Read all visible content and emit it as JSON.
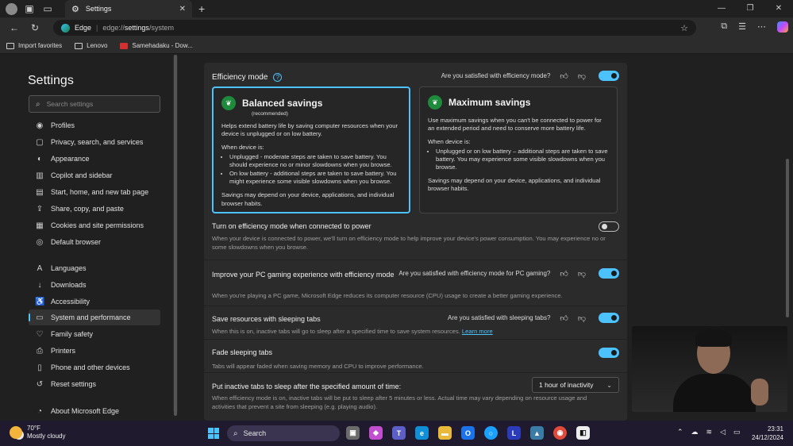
{
  "browser": {
    "tab_title": "Settings",
    "address_site": "Edge",
    "address_url_prefix": "edge://",
    "address_url_bold": "settings",
    "address_url_suffix": "/system",
    "favorites": [
      {
        "label": "Import favorites"
      },
      {
        "label": "Lenovo"
      },
      {
        "label": "Samehadaku - Dow..."
      }
    ]
  },
  "sidebar": {
    "title": "Settings",
    "search_placeholder": "Search settings",
    "items": [
      {
        "label": "Profiles",
        "icon": "profile-icon"
      },
      {
        "label": "Privacy, search, and services",
        "icon": "lock-icon"
      },
      {
        "label": "Appearance",
        "icon": "palette-icon"
      },
      {
        "label": "Copilot and sidebar",
        "icon": "sidebar-icon"
      },
      {
        "label": "Start, home, and new tab page",
        "icon": "home-icon"
      },
      {
        "label": "Share, copy, and paste",
        "icon": "share-icon"
      },
      {
        "label": "Cookies and site permissions",
        "icon": "cookie-icon"
      },
      {
        "label": "Default browser",
        "icon": "browser-icon"
      },
      {
        "label": "Languages",
        "icon": "language-icon"
      },
      {
        "label": "Downloads",
        "icon": "download-icon"
      },
      {
        "label": "Accessibility",
        "icon": "accessibility-icon"
      },
      {
        "label": "System and performance",
        "icon": "laptop-icon"
      },
      {
        "label": "Family safety",
        "icon": "family-icon"
      },
      {
        "label": "Printers",
        "icon": "printer-icon"
      },
      {
        "label": "Phone and other devices",
        "icon": "phone-icon"
      },
      {
        "label": "Reset settings",
        "icon": "reset-icon"
      },
      {
        "label": "About Microsoft Edge",
        "icon": "edge-icon"
      }
    ]
  },
  "efficiency": {
    "heading": "Efficiency mode",
    "feedback_question": "Are you satisfied with efficiency mode?",
    "enabled": true,
    "balanced": {
      "title": "Balanced savings",
      "badge": "(recommended)",
      "desc": "Helps extend battery life by saving computer resources when your device is unplugged or on low battery.",
      "when": "When device is:",
      "bullets": [
        "Unplugged - moderate steps are taken to save battery. You should experience no or minor slowdowns when you browse.",
        "On low battery - additional steps are taken to save battery. You might experience some visible slowdowns when you browse."
      ],
      "note": "Savings may depend on your device, applications, and individual browser habits."
    },
    "maximum": {
      "title": "Maximum savings",
      "desc": "Use maximum savings when you can't be connected to power for an extended period and need to conserve more battery life.",
      "when": "When device is:",
      "bullets": [
        "Unplugged or on low battery – additional steps are taken to save battery. You may experience some visible slowdowns when you browse."
      ],
      "note": "Savings may depend on your device, applications, and individual browser habits."
    }
  },
  "rows": {
    "power": {
      "title": "Turn on efficiency mode when connected to power",
      "desc": "When your device is connected to power, we'll turn on efficiency mode to help improve your device's power consumption. You may experience no or some slowdowns when you browse.",
      "enabled": false
    },
    "gaming": {
      "title": "Improve your PC gaming experience with efficiency mode",
      "feedback_question": "Are you satisfied with efficiency mode for PC gaming?",
      "desc": "When you're playing a PC game, Microsoft Edge reduces its computer resource (CPU) usage to create a better gaming experience.",
      "enabled": true
    },
    "sleeping": {
      "title": "Save resources with sleeping tabs",
      "feedback_question": "Are you satisfied with sleeping tabs?",
      "desc": "When this is on, inactive tabs will go to sleep after a specified time to save system resources.",
      "link": "Learn more",
      "enabled": true
    },
    "fade": {
      "title": "Fade sleeping tabs",
      "desc": "Tabs will appear faded when saving memory and CPU to improve performance.",
      "enabled": true
    },
    "inactive": {
      "title": "Put inactive tabs to sleep after the specified amount of time:",
      "desc": "When efficiency mode is on, inactive tabs will be put to sleep after 5 minutes or less. Actual time may vary depending on resource usage and activities that prevent a site from sleeping (e.g. playing audio).",
      "selected": "1 hour of inactivity"
    }
  },
  "taskbar": {
    "temperature": "70°F",
    "condition": "Mostly cloudy",
    "search_label": "Search",
    "time": "23:31",
    "date": "24/12/2024"
  },
  "colors": {
    "accent": "#4cc2ff",
    "leaf_green": "#1e8a3c"
  }
}
